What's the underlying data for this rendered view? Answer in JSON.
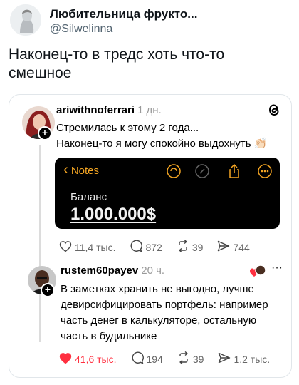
{
  "author": {
    "name": "Любительница фрукто...",
    "handle": "@Silwelinna"
  },
  "tweet": {
    "text_line1": "Наконец-то в тредс хоть что-то",
    "text_line2": "смешное"
  },
  "post1": {
    "username": "ariwithnoferrari",
    "time": "1 дн.",
    "text_line1": "Стремилась к этому 2 года...",
    "text_line2": "Наконец-то я могу спокойно выдохнуть",
    "emoji": "👏🏻",
    "likes": "11,4 тыс.",
    "comments": "872",
    "reposts": "39",
    "shares": "744"
  },
  "notes_screenshot": {
    "back_label": "Notes",
    "balance_label": "Баланс",
    "amount": "1.000.000$"
  },
  "post2": {
    "username": "rustem60payev",
    "time": "20 ч.",
    "more": "···",
    "text_line1": "В заметках хранить не выгодно, лучше",
    "text_line2": "девирсифицировать портфель: например",
    "text_line3": "часть денег в калькуляторе, остальную",
    "text_line4": "часть в будильнике",
    "likes": "41,6 тыс.",
    "comments": "194",
    "reposts": "39",
    "shares": "1,2 тыс."
  },
  "colors": {
    "like_red": "#ff3040",
    "notes_accent": "#f5a623"
  },
  "icons": [
    "threads-logo-icon",
    "heart-icon",
    "comment-icon",
    "repost-icon",
    "share-icon",
    "plus-icon"
  ]
}
